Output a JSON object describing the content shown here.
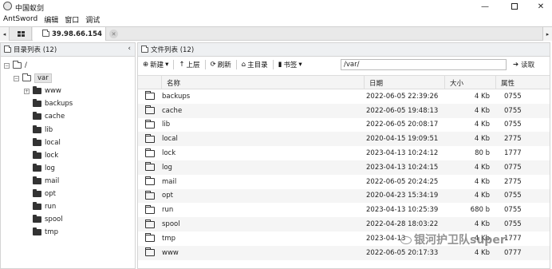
{
  "window": {
    "title": "中国蚁剑",
    "minimize": "—",
    "close": "✕"
  },
  "menu": [
    "AntSword",
    "编辑",
    "窗口",
    "调试"
  ],
  "tabs": {
    "left_arrow": "◂",
    "right_arrow": "▸",
    "active_label": "39.98.66.154",
    "close_label": "✕"
  },
  "left_panel": {
    "title": "目录列表 (12)",
    "collapse": "‹",
    "root_label": "/",
    "var_label": "var",
    "children": [
      "www",
      "backups",
      "cache",
      "lib",
      "local",
      "lock",
      "log",
      "mail",
      "opt",
      "run",
      "spool",
      "tmp"
    ]
  },
  "right_panel": {
    "title": "文件列表 (12)",
    "toolbar": {
      "new": "新建",
      "up": "上层",
      "refresh": "刷新",
      "home": "主目录",
      "bookmark": "书签",
      "path": "/var/",
      "read": "读取"
    },
    "columns": {
      "name": "名称",
      "date": "日期",
      "size": "大小",
      "perm": "属性"
    },
    "rows": [
      {
        "name": "backups",
        "date": "2022-06-05 22:39:26",
        "size": "4 Kb",
        "perm": "0755"
      },
      {
        "name": "cache",
        "date": "2022-06-05 19:48:13",
        "size": "4 Kb",
        "perm": "0755"
      },
      {
        "name": "lib",
        "date": "2022-06-05 20:08:17",
        "size": "4 Kb",
        "perm": "0755"
      },
      {
        "name": "local",
        "date": "2020-04-15 19:09:51",
        "size": "4 Kb",
        "perm": "2775"
      },
      {
        "name": "lock",
        "date": "2023-04-13 10:24:12",
        "size": "80 b",
        "perm": "1777"
      },
      {
        "name": "log",
        "date": "2023-04-13 10:24:15",
        "size": "4 Kb",
        "perm": "0775"
      },
      {
        "name": "mail",
        "date": "2022-06-05 20:24:25",
        "size": "4 Kb",
        "perm": "2775"
      },
      {
        "name": "opt",
        "date": "2020-04-23 15:34:19",
        "size": "4 Kb",
        "perm": "0755"
      },
      {
        "name": "run",
        "date": "2023-04-13 10:25:39",
        "size": "680 b",
        "perm": "0755"
      },
      {
        "name": "spool",
        "date": "2022-04-28 18:03:22",
        "size": "4 Kb",
        "perm": "0755"
      },
      {
        "name": "tmp",
        "date": "2023-04-13",
        "size": "4 Kb",
        "perm": "1777"
      },
      {
        "name": "www",
        "date": "2022-06-05 20:17:33",
        "size": "4 Kb",
        "perm": "0777"
      }
    ]
  },
  "watermark": "银河护卫队super"
}
